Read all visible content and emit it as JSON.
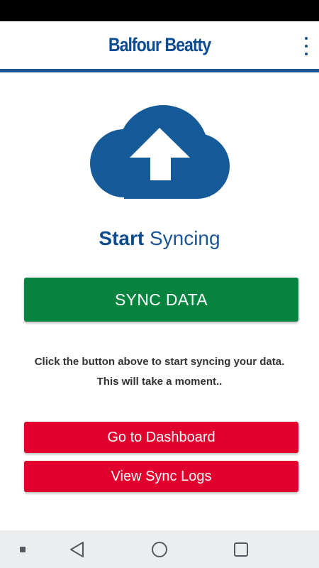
{
  "app": {
    "brand": "Balfour Beatty",
    "menu_icon": "more-vert-icon"
  },
  "hero": {
    "icon": "cloud-upload-icon",
    "headline_bold": "Start",
    "headline_rest": " Syncing"
  },
  "actions": {
    "sync_label": "SYNC DATA",
    "dashboard_label": "Go to Dashboard",
    "logs_label": "View Sync Logs"
  },
  "helper": {
    "line1": "Click the button above to start syncing your data.",
    "line2": "This will take a moment.."
  },
  "nav_bar": {
    "icons": [
      "recent-apps-dot-icon",
      "back-icon",
      "home-icon",
      "overview-icon"
    ]
  },
  "colors": {
    "brand_blue": "#0d4c92",
    "sync_green": "#06843f",
    "action_red": "#e1002d"
  }
}
